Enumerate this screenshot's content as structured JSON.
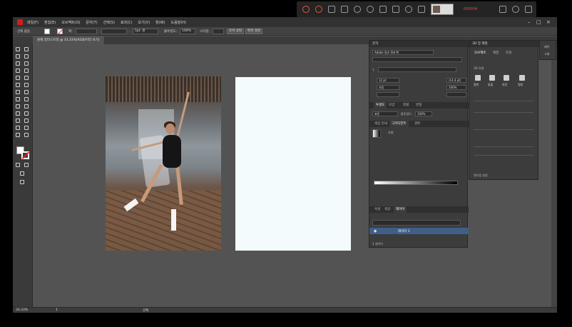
{
  "menubar": {
    "items": [
      "파일(F)",
      "편집(E)",
      "오브젝트(O)",
      "문자(T)",
      "선택(S)",
      "효과(C)",
      "보기(V)",
      "창(W)",
      "도움말(H)"
    ]
  },
  "capture_toolbar": {
    "icons": [
      "record-icon",
      "record-alt-icon",
      "screen-icon",
      "pen-icon",
      "zoom-in-icon",
      "zoom-out-icon",
      "text-box-icon",
      "highlight-icon",
      "drop-icon",
      "eraser-icon",
      "thumbnail",
      "cursor-icon",
      "settings-icon",
      "close-icon"
    ],
    "accent_color": "#e35a3c",
    "red_text": "000004"
  },
  "controlbar": {
    "selection_label": "선택 없음",
    "stroke_label": "획:",
    "brush_value": "5pt. 원",
    "opacity_label": "불투명도:",
    "opacity_value": "100%",
    "style_label": "스타일:",
    "doc_setup_button": "문서 설정",
    "prefs_button": "환경 설정"
  },
  "doc_tab": {
    "title": "원재 일러스트레 @ 33.33%(RGB/미리 보기)"
  },
  "statusbar": {
    "zoom": "33.33%",
    "page": "1",
    "tool": "선택"
  },
  "properties_panel": {
    "char_tab": "문자",
    "font": "Adobe 명조 Std M",
    "size_value": "12 pt",
    "tracking_value": "(14.4 pt)",
    "scale_value": "100%",
    "kerning_value": "자동",
    "para_tabs": [
      "투명도",
      "모양",
      "정렬",
      "변형"
    ],
    "blend_mode": "표준",
    "opacity_label": "불투명도:",
    "opacity_value": "100%",
    "gradient_tabs": [
      "색상 안내",
      "그라디언트",
      "견본"
    ],
    "gradient_type_label": "유형:",
    "layers_tabs": [
      "속성",
      "색상",
      "레이어"
    ],
    "layer_name": "레이어 1",
    "layer_count": "1 레이어",
    "layer_color": "#3f5f88"
  },
  "panel_3d": {
    "title": "3D 및 재질",
    "tabs": [
      "오브젝트",
      "재질",
      "조명"
    ],
    "type_label": "3D 유형",
    "types": [
      "평면",
      "돌출",
      "회전",
      "팽창"
    ],
    "footer": "렌더링 설정"
  },
  "panel_strip": {
    "items": [
      "레이",
      "그래"
    ]
  },
  "colors": {
    "chrome": "#535353",
    "panel": "#3c3c3c",
    "menubar": "#323232",
    "artboard_blank": "#f4fbfc"
  }
}
